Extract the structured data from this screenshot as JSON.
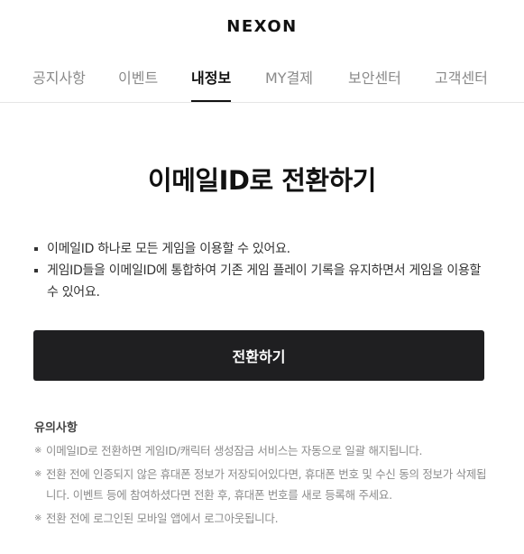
{
  "header": {
    "logo": "NEXON"
  },
  "nav": {
    "tabs": [
      {
        "label": "공지사항",
        "active": false
      },
      {
        "label": "이벤트",
        "active": false
      },
      {
        "label": "내정보",
        "active": true
      },
      {
        "label": "MY결제",
        "active": false
      },
      {
        "label": "보안센터",
        "active": false
      },
      {
        "label": "고객센터",
        "active": false
      }
    ]
  },
  "main": {
    "title": "이메일ID로 전환하기",
    "bullets": [
      "이메일ID 하나로 모든 게임을 이용할 수 있어요.",
      "게임ID들을 이메일ID에 통합하여 기존 게임 플레이 기록을 유지하면서 게임을 이용할 수 있어요."
    ],
    "button_label": "전환하기",
    "notice": {
      "title": "유의사항",
      "mark": "※",
      "items": [
        "이메일ID로 전환하면 게임ID/캐릭터 생성잠금 서비스는 자동으로 일괄 해지됩니다.",
        "전환 전에 인증되지 않은 휴대폰 정보가 저장되어있다면, 휴대폰 번호 및 수신 동의 정보가 삭제됩니다. 이벤트 등에 참여하셨다면 전환 후, 휴대폰 번호를 새로 등록해 주세요.",
        "전환 전에 로그인된 모바일 앱에서 로그아웃됩니다."
      ]
    }
  }
}
